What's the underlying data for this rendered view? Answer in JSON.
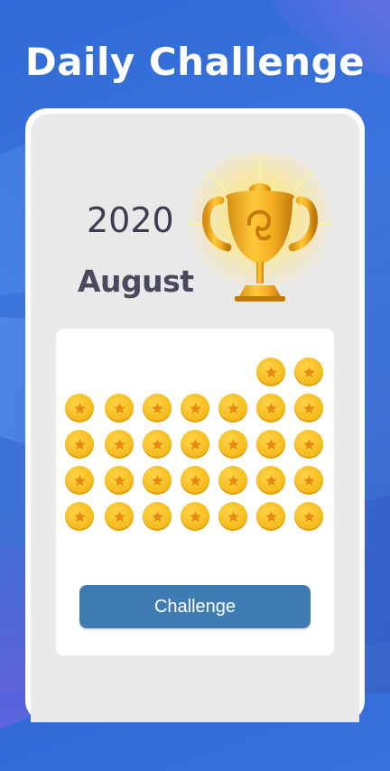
{
  "header": {
    "title": "Daily Challenge"
  },
  "date": {
    "year": "2020",
    "month": "August"
  },
  "calendar": {
    "completed_days": 30,
    "coin_icon": "star-coin-icon"
  },
  "actions": {
    "challenge_label": "Challenge"
  },
  "colors": {
    "background": "#3b74dd",
    "button": "#3e7cb1",
    "coin": "#f6bd1f",
    "star": "#e88a10",
    "text_dark": "#3c3c52"
  }
}
